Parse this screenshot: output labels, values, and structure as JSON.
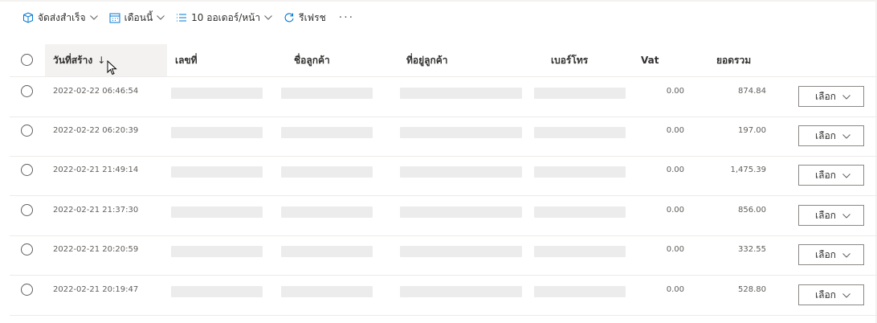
{
  "toolbar": {
    "ship_label": "จัดส่งสำเร็จ",
    "period_label": "เดือนนี้",
    "page_size_label": "10 ออเดอร์/หน้า",
    "refresh_label": "รีเฟรช",
    "more_label": "···"
  },
  "table": {
    "columns": {
      "created": "วันที่สร้าง",
      "sort_arrow": "↓",
      "number": "เลขที่",
      "customer_name": "ชื่อลูกค้า",
      "customer_address": "ที่อยู่ลูกค้า",
      "phone": "เบอร์โทร",
      "vat": "Vat",
      "total": "ยอดรวม"
    },
    "rows": [
      {
        "date": "2022-02-22 06:46:54",
        "vat": "0.00",
        "total": "874.84",
        "action": "เลือก"
      },
      {
        "date": "2022-02-22 06:20:39",
        "vat": "0.00",
        "total": "197.00",
        "action": "เลือก"
      },
      {
        "date": "2022-02-21 21:49:14",
        "vat": "0.00",
        "total": "1,475.39",
        "action": "เลือก"
      },
      {
        "date": "2022-02-21 21:37:30",
        "vat": "0.00",
        "total": "856.00",
        "action": "เลือก"
      },
      {
        "date": "2022-02-21 20:20:59",
        "vat": "0.00",
        "total": "332.55",
        "action": "เลือก"
      },
      {
        "date": "2022-02-21 20:19:47",
        "vat": "0.00",
        "total": "528.80",
        "action": "เลือก"
      }
    ]
  },
  "colors": {
    "header_sorted_bg": "#f3f2f1",
    "placeholder": "#ececec",
    "border": "#edebe9"
  }
}
